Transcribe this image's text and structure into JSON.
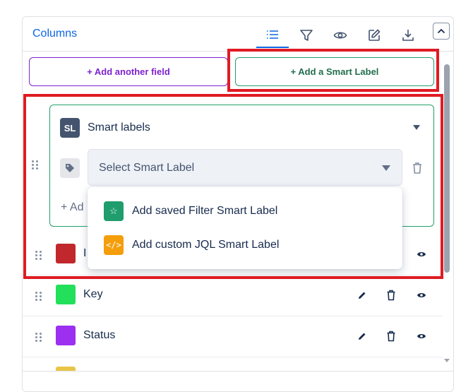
{
  "header": {
    "title": "Columns",
    "toolbar": [
      "list-icon",
      "filter-icon",
      "eye-icon",
      "edit-icon",
      "download-icon"
    ],
    "collapse_icon": "chevron-up-icon"
  },
  "actions": {
    "add_field_label": "+ Add another field",
    "add_smart_label": "+ Add a Smart Label"
  },
  "smart_card": {
    "badge": "SL",
    "title": "Smart labels",
    "select_placeholder": "Select Smart Label",
    "add_text": "+ Ad"
  },
  "dropdown": {
    "options": [
      {
        "label": "Add saved Filter Smart Label",
        "icon": "star-icon",
        "glyph": "☆",
        "color": "#1f9d6c"
      },
      {
        "label": "Add custom JQL Smart Label",
        "icon": "code-icon",
        "glyph": "</>",
        "color": "#f59e0b"
      }
    ]
  },
  "rows": [
    {
      "label": "I",
      "color": "#c0282d"
    },
    {
      "label": "Key",
      "color": "#22e05a"
    },
    {
      "label": "Status",
      "color": "#9d2ff0"
    }
  ],
  "colors": {
    "accent": "#0c66e4",
    "highlight": "#e01b24"
  }
}
